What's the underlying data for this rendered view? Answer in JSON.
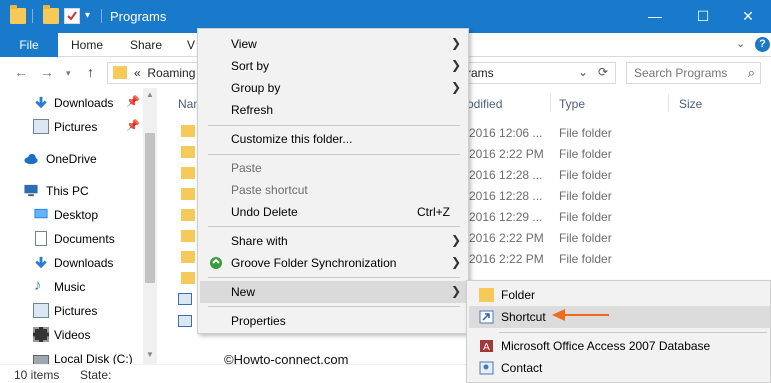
{
  "window": {
    "title": "Programs",
    "controls": {
      "minimize": "—",
      "maximize": "☐",
      "close": "✕"
    }
  },
  "ribbon": {
    "file": "File",
    "tabs": [
      "Home",
      "Share",
      "V"
    ],
    "help": "?"
  },
  "address": {
    "chevrons": "«",
    "crumb": "Roaming",
    "crumb_end": "rams",
    "dropdown": "⌄",
    "refresh": "⟳"
  },
  "search": {
    "placeholder": "Search Programs",
    "icon": "search-icon"
  },
  "nav_pane": [
    {
      "label": "Downloads",
      "icon": "download-icon",
      "pinned": true
    },
    {
      "label": "Pictures",
      "icon": "pictures-icon",
      "pinned": true
    },
    {
      "label": "OneDrive",
      "icon": "cloud-icon"
    },
    {
      "label": "This PC",
      "icon": "computer-icon"
    },
    {
      "label": "Desktop",
      "icon": "desktop-icon"
    },
    {
      "label": "Documents",
      "icon": "documents-icon"
    },
    {
      "label": "Downloads",
      "icon": "download-icon"
    },
    {
      "label": "Music",
      "icon": "music-icon"
    },
    {
      "label": "Pictures",
      "icon": "pictures-icon"
    },
    {
      "label": "Videos",
      "icon": "videos-icon"
    },
    {
      "label": "Local Disk (C:)",
      "icon": "disk-icon"
    }
  ],
  "columns": {
    "name": "Nam",
    "modified": "odified",
    "type": "Type",
    "size": "Size"
  },
  "rows": [
    {
      "modified": "2016 12:06 ...",
      "type": "File folder"
    },
    {
      "modified": "2016 2:22 PM",
      "type": "File folder"
    },
    {
      "modified": "2016 12:28 ...",
      "type": "File folder"
    },
    {
      "modified": "2016 12:28 ...",
      "type": "File folder"
    },
    {
      "modified": "2016 12:29 ...",
      "type": "File folder"
    },
    {
      "modified": "2016 2:22 PM",
      "type": "File folder"
    },
    {
      "modified": "2016 2:22 PM",
      "type": "File folder"
    }
  ],
  "status": {
    "count": "10 items",
    "state": "State:"
  },
  "context_menu": {
    "items": [
      {
        "label": "View",
        "submenu": true
      },
      {
        "label": "Sort by",
        "submenu": true
      },
      {
        "label": "Group by",
        "submenu": true
      },
      {
        "label": "Refresh"
      },
      {
        "label": "Customize this folder..."
      },
      {
        "label": "Paste",
        "disabled": true
      },
      {
        "label": "Paste shortcut",
        "disabled": true
      },
      {
        "label": "Undo Delete",
        "shortcut": "Ctrl+Z"
      },
      {
        "label": "Share with",
        "submenu": true
      },
      {
        "label": "Groove Folder Synchronization",
        "submenu": true
      },
      {
        "label": "New",
        "submenu": true
      },
      {
        "label": "Properties"
      }
    ]
  },
  "new_submenu": {
    "items": [
      {
        "label": "Folder",
        "icon": "folder-icon"
      },
      {
        "label": "Shortcut",
        "icon": "shortcut-icon"
      },
      {
        "label": "Microsoft Office Access 2007 Database",
        "icon": "access-icon"
      },
      {
        "label": "Contact",
        "icon": "contact-icon"
      }
    ]
  },
  "watermark": "©Howto-connect.com",
  "colors": {
    "titlebar": "#1979ca",
    "annotation_arrow": "#f26a1b",
    "folder": "#f6c95b"
  }
}
